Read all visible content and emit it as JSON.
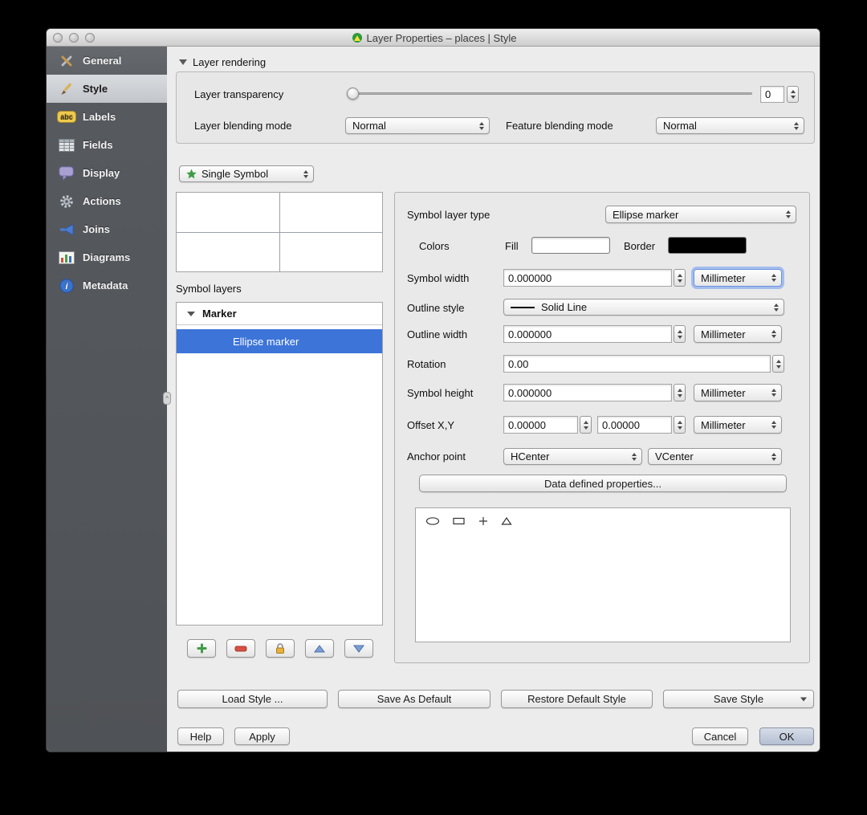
{
  "window": {
    "title": "Layer Properties – places | Style"
  },
  "sidebar": {
    "items": [
      {
        "label": "General"
      },
      {
        "label": "Style"
      },
      {
        "label": "Labels"
      },
      {
        "label": "Fields"
      },
      {
        "label": "Display"
      },
      {
        "label": "Actions"
      },
      {
        "label": "Joins"
      },
      {
        "label": "Diagrams"
      },
      {
        "label": "Metadata"
      }
    ],
    "labels_icon_text": "abc",
    "metadata_icon_text": "i"
  },
  "layer_rendering": {
    "header": "Layer rendering",
    "transparency_label": "Layer transparency",
    "transparency_value": "0",
    "blending_label": "Layer blending mode",
    "blending_value": "Normal",
    "feature_blending_label": "Feature blending mode",
    "feature_blending_value": "Normal"
  },
  "symbol": {
    "renderer": "Single Symbol",
    "layers_label": "Symbol layers",
    "group_label": "Marker",
    "selected_layer": "Ellipse marker"
  },
  "props": {
    "type_label": "Symbol layer type",
    "type_value": "Ellipse marker",
    "colors_label": "Colors",
    "fill_label": "Fill",
    "border_label": "Border",
    "width_label": "Symbol width",
    "width_value": "0.000000",
    "outline_style_label": "Outline style",
    "outline_style_value": "Solid Line",
    "outline_width_label": "Outline width",
    "outline_width_value": "0.000000",
    "rotation_label": "Rotation",
    "rotation_value": "0.00",
    "height_label": "Symbol height",
    "height_value": "0.000000",
    "offset_label": "Offset X,Y",
    "offset_x": "0.00000",
    "offset_y": "0.00000",
    "anchor_label": "Anchor point",
    "anchor_h": "HCenter",
    "anchor_v": "VCenter",
    "unit": "Millimeter",
    "data_defined": "Data defined properties..."
  },
  "footer": {
    "load_style": "Load Style ...",
    "save_default": "Save As Default",
    "restore_default": "Restore Default Style",
    "save_style": "Save Style",
    "help": "Help",
    "apply": "Apply",
    "cancel": "Cancel",
    "ok": "OK"
  },
  "colors": {
    "selection": "#3d74d8",
    "fill_swatch": "#ffffff",
    "border_swatch": "#000000"
  }
}
